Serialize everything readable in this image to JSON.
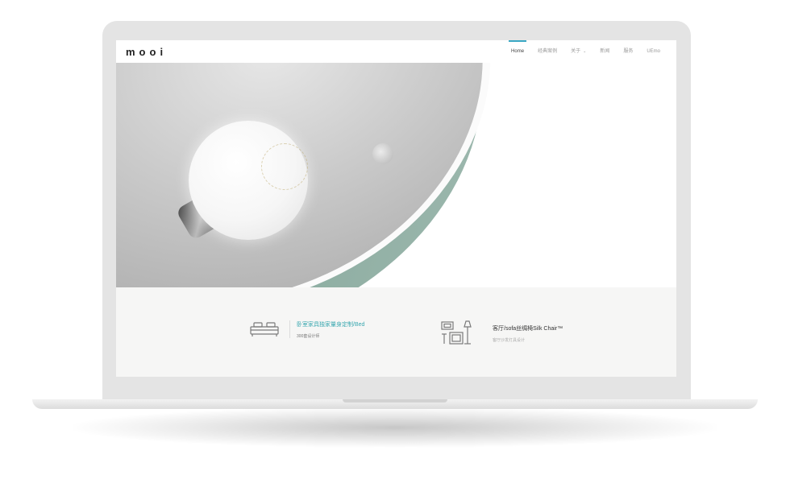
{
  "brand": {
    "logo": "mooi"
  },
  "nav": {
    "items": [
      {
        "label": "Home"
      },
      {
        "label": "经典案例"
      },
      {
        "label": "关于"
      },
      {
        "label": "新闻"
      },
      {
        "label": "服务"
      },
      {
        "label": "UEmo"
      }
    ],
    "dropdown_chevron": "⌄"
  },
  "features": [
    {
      "icon": "bed-icon",
      "title": "卧室家具独家量身定制/Bed",
      "subtitle": "300套设计师"
    },
    {
      "icon": "living-room-icon",
      "title": "客厅/sofa丝绸椅Silk Chair™",
      "subtitle": "客厅沙发灯具设计"
    }
  ],
  "colors": {
    "accent": "#3aa8c4",
    "feature_accent": "#3aa8b0",
    "lamp_green": "#8fb0a4"
  }
}
